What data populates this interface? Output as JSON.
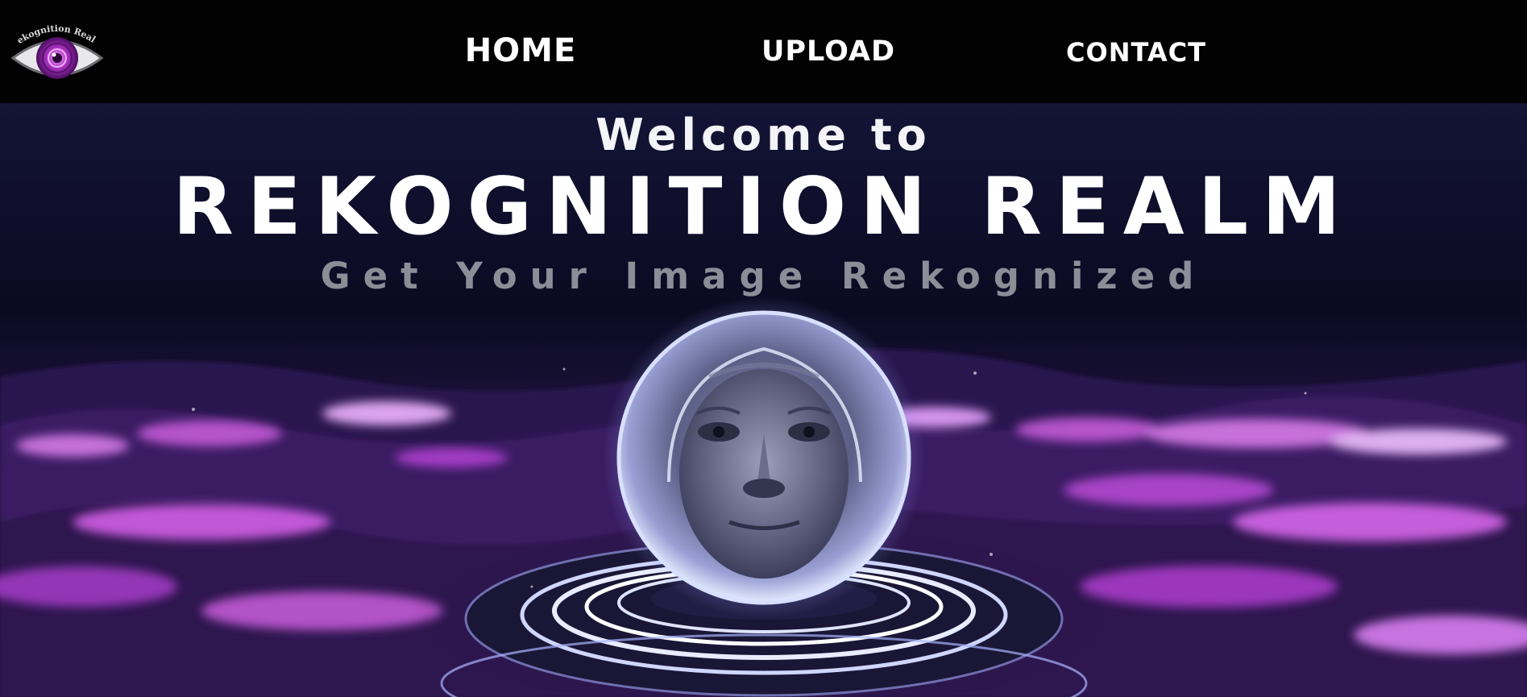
{
  "app": {
    "logo_text": "Rekognition Realm"
  },
  "nav": {
    "items": [
      {
        "label": "HOME"
      },
      {
        "label": "UPLOAD"
      },
      {
        "label": "CONTACT"
      }
    ]
  },
  "hero": {
    "welcome": "Welcome to",
    "title": "REKOGNITION REALM",
    "tagline": "Get Your Image Rekognized",
    "image_subject": "crystal-ball-with-face-icon"
  },
  "colors": {
    "nav_background": "#020203",
    "nav_text": "#ffffff",
    "hero_background": "#0b0a22",
    "accent_purple": "#c23bd6",
    "tagline": "#8d8d98"
  }
}
